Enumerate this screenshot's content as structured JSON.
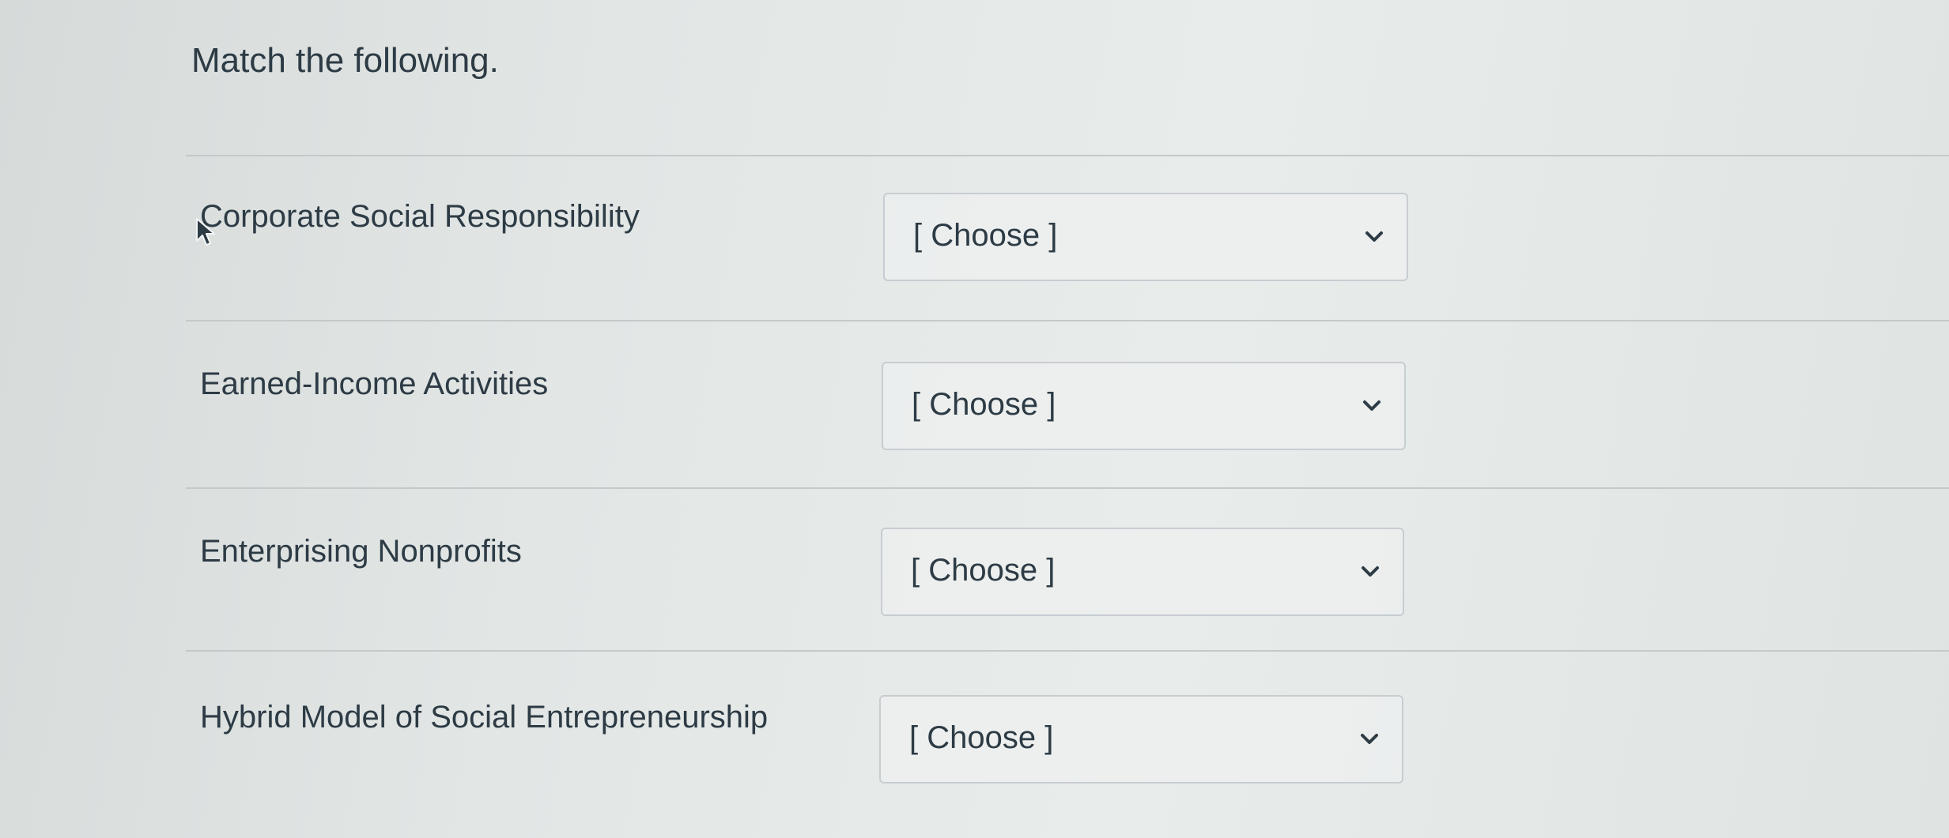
{
  "question": {
    "prompt": "Match the following."
  },
  "rows": [
    {
      "label": "Corporate Social Responsibility",
      "selected": "[ Choose ]"
    },
    {
      "label": "Earned-Income Activities",
      "selected": "[ Choose ]"
    },
    {
      "label": "Enterprising Nonprofits",
      "selected": "[ Choose ]"
    },
    {
      "label": "Hybrid Model of Social Entrepreneurship",
      "selected": "[ Choose ]"
    }
  ],
  "icons": {
    "dropdown": "chevron-down-icon",
    "cursor": "mouse-cursor-icon"
  },
  "colors": {
    "text": "#2d3b45",
    "border": "#c7cdd1"
  }
}
